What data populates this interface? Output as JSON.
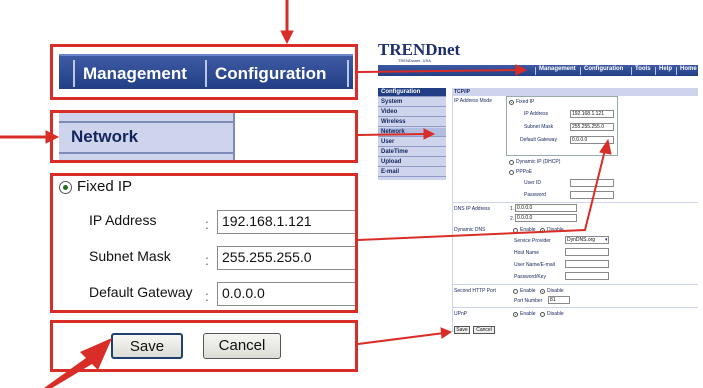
{
  "nav": {
    "management": "Management",
    "configuration": "Configuration",
    "tools": "Tools",
    "help": "Help",
    "home": "Home"
  },
  "logo": {
    "brand": "TRENDnet",
    "tagline": "TRENDware, USA"
  },
  "sidebar": {
    "header": "Configuration",
    "items": [
      "System",
      "Video",
      "Wireless",
      "Network",
      "User",
      "DateTime",
      "Upload",
      "E-mail"
    ],
    "active": "Network"
  },
  "content": {
    "section": "TCP/IP",
    "ip_mode_label": "IP Address Mode",
    "fixed_ip": "Fixed IP",
    "ip_address_label": "IP Address",
    "ip_address": "192.168.1.121",
    "subnet_label": "Subnet Mask",
    "subnet": "255.255.255.0",
    "gateway_label": "Default Gateway",
    "gateway": "0.0.0.0",
    "dhcp": "Dynamic IP (DHCP)",
    "pppoe": "PPPoE",
    "user_id_label": "User ID",
    "password_label": "Password",
    "dns_label": "DNS IP Address",
    "dns1_index": "1.",
    "dns1": "0.0.0.0",
    "dns2_index": "2.",
    "dns2": "0.0.0.0",
    "ddns_label": "Dynamic DNS",
    "enable": "Enable",
    "disable": "Disable",
    "service_provider_label": "Service Provider",
    "service_provider": "DynDNS.org",
    "host_name_label": "Host Name",
    "user_email_label": "User Name/E-mail",
    "password_key_label": "Password/Key",
    "http_label": "Second HTTP Port",
    "port_label": "Port Number",
    "port": "81",
    "upnp_label": "UPnP"
  },
  "buttons": {
    "save": "Save",
    "cancel": "Cancel"
  },
  "colors": {
    "callout": "#d92d27",
    "nav": "#223f86",
    "sidebar": "#cdd4ec"
  }
}
